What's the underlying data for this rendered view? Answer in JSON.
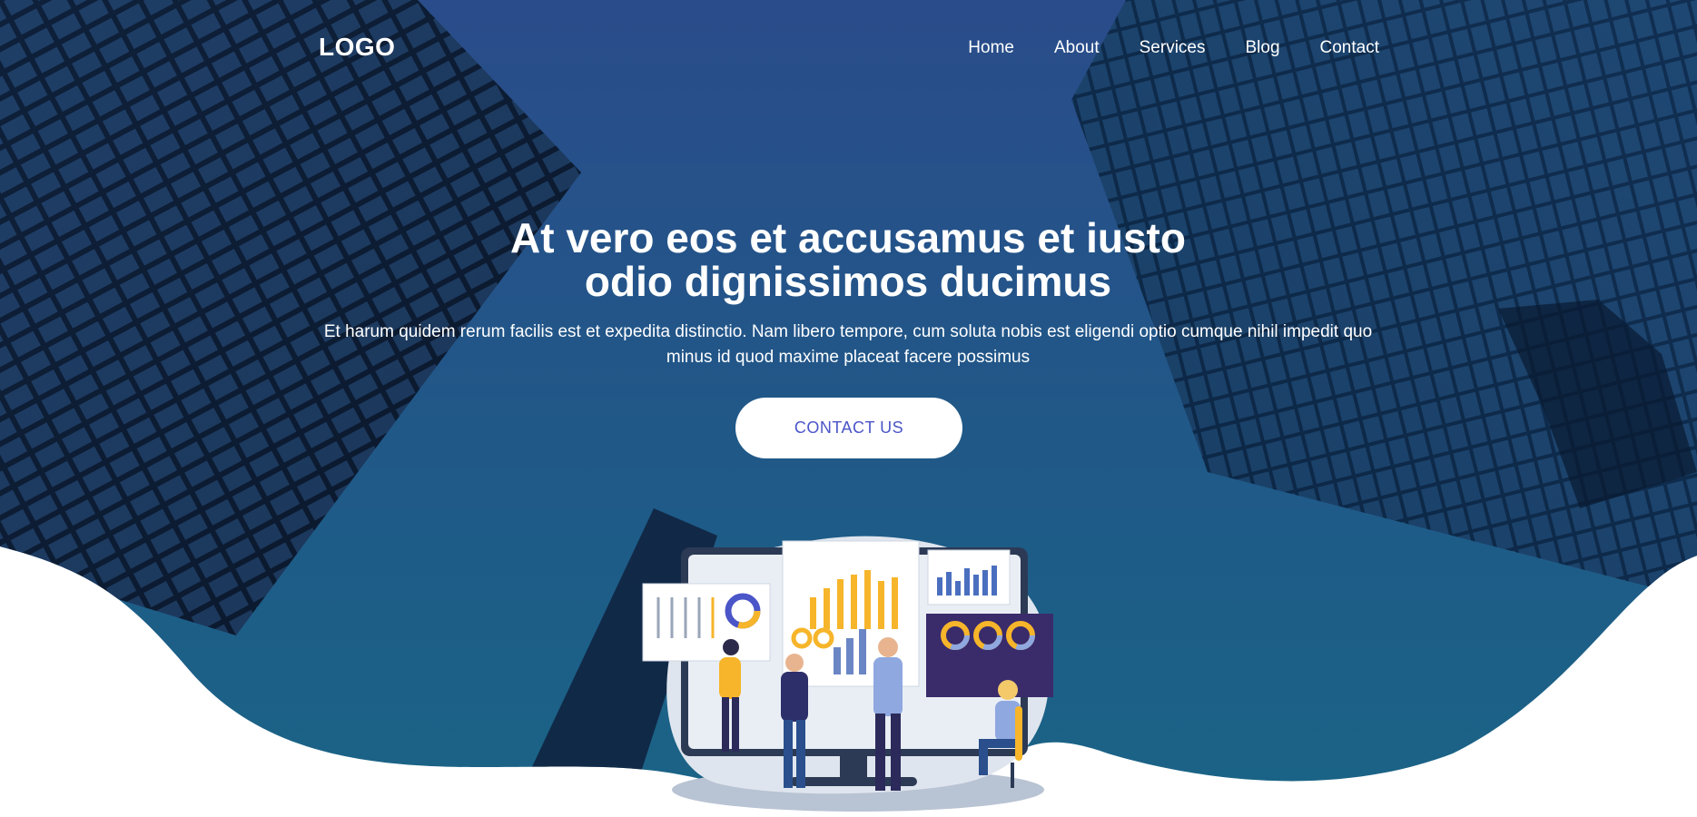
{
  "header": {
    "logo": "LOGO",
    "nav": [
      {
        "label": "Home"
      },
      {
        "label": "About"
      },
      {
        "label": "Services"
      },
      {
        "label": "Blog"
      },
      {
        "label": "Contact"
      }
    ]
  },
  "hero": {
    "title_line1": "At vero eos et accusamus et iusto",
    "title_line2": "odio dignissimos ducimus",
    "subtitle_line1": "Et harum quidem rerum facilis est et expedita distinctio. Nam libero tempore, cum soluta nobis est eligendi optio cumque nihil impedit quo",
    "subtitle_line2": "minus id quod maxime placeat facere possimus",
    "cta_label": "CONTACT US"
  },
  "colors": {
    "sky_top": "#2a4f8c",
    "sky_bottom": "#1c5f86",
    "building_dark": "#0e1e36",
    "cta_text": "#4a55c8",
    "accent_yellow": "#f6b52a",
    "accent_purple": "#3a2b6b"
  }
}
